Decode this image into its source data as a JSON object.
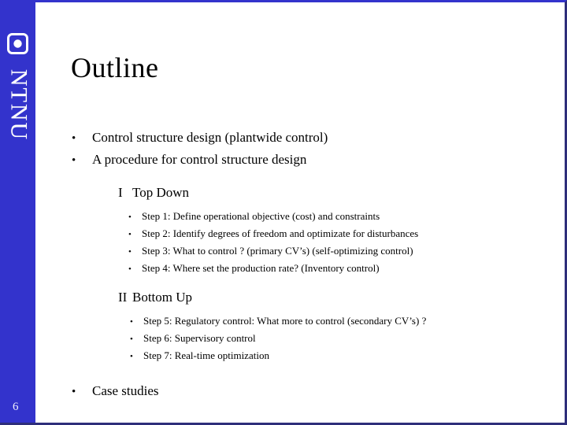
{
  "slide": {
    "page_number": "6",
    "title": "Outline",
    "accent_color": "#3333CC",
    "background_color": "#FFFFFF",
    "text_color": "#000000"
  },
  "branding": {
    "wordmark": "NTNU",
    "logo_icon": "rounded-square-with-circle-icon"
  },
  "bullets": {
    "glyph": "•",
    "main": [
      {
        "text": "Control structure design (plantwide control)"
      },
      {
        "text": "A procedure for control structure design"
      }
    ],
    "case_studies": {
      "text": "Case studies"
    }
  },
  "sections": [
    {
      "numeral": "I",
      "heading": "Top Down",
      "steps": [
        "Step 1: Define operational objective (cost) and constraints",
        "Step 2: Identify degrees of freedom and optimizate for disturbances",
        "Step 3: What to control ? (primary CV’s) (self-optimizing control)",
        "Step 4: Where set the production rate? (Inventory control)"
      ]
    },
    {
      "numeral": "II",
      "heading": "Bottom Up",
      "steps": [
        "Step 5: Regulatory control: What more to control (secondary CV’s) ?",
        "Step 6: Supervisory control",
        "Step 7: Real-time optimization"
      ]
    }
  ]
}
